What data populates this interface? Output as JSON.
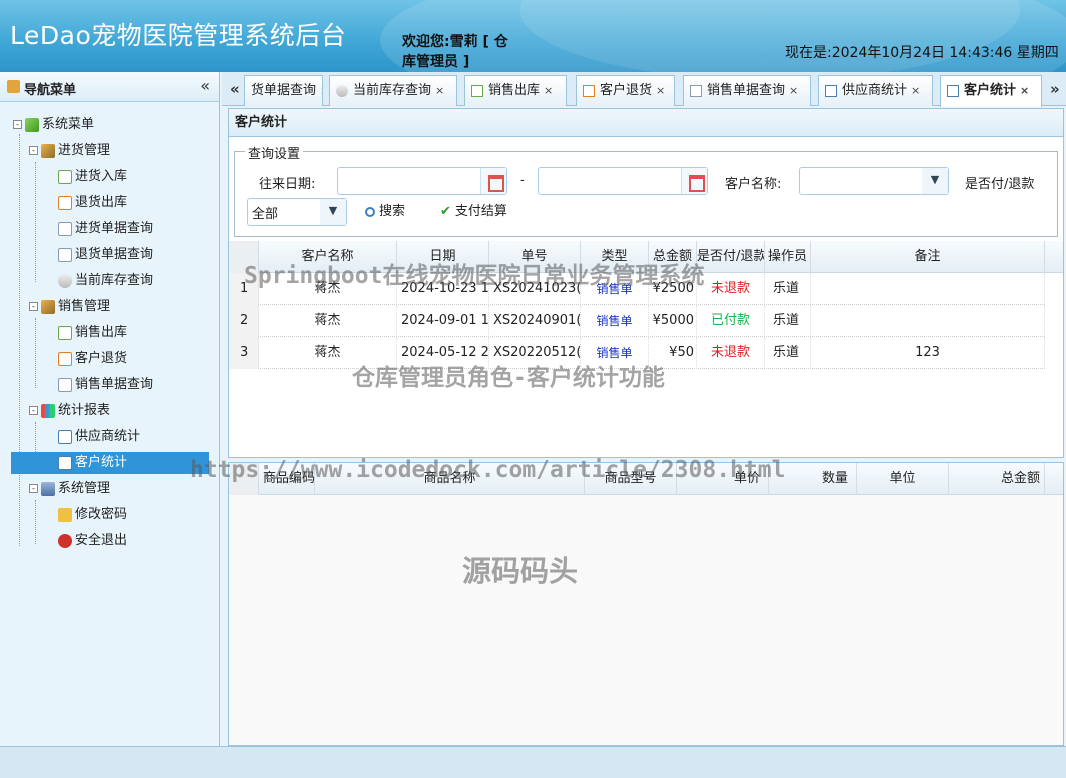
{
  "header": {
    "title": "LeDao宠物医院管理系统后台",
    "welcome": "欢迎您:雪莉 [ 仓库管理员 ]",
    "datetime": "现在是:2024年10月24日 14:43:46 星期四"
  },
  "sidebar": {
    "title": "导航菜单",
    "collapse": "«",
    "root": "系统菜单",
    "groups": [
      {
        "label": "进货管理",
        "items": [
          "进货入库",
          "退货出库",
          "进货单据查询",
          "退货单据查询",
          "当前库存查询"
        ]
      },
      {
        "label": "销售管理",
        "items": [
          "销售出库",
          "客户退货",
          "销售单据查询"
        ]
      },
      {
        "label": "统计报表",
        "items": [
          "供应商统计",
          "客户统计"
        ]
      },
      {
        "label": "系统管理",
        "items": [
          "修改密码",
          "安全退出"
        ]
      }
    ],
    "selected": "客户统计"
  },
  "tabs": {
    "left_arrow": "«",
    "right_arrow": "»",
    "items": [
      "货单据查询",
      "当前库存查询",
      "销售出库",
      "客户退货",
      "销售单据查询",
      "供应商统计",
      "客户统计"
    ],
    "active": "客户统计",
    "close": "×"
  },
  "panel": {
    "title": "客户统计",
    "query_legend": "查询设置",
    "date_label": "往来日期:",
    "date_sep": "-",
    "date_from": "",
    "date_to": "",
    "customer_label": "客户名称:",
    "customer_value": "",
    "paid_label": "是否付/退款",
    "paid_value": "全部",
    "search_btn": "搜索",
    "settle_btn": "支付结算"
  },
  "grid": {
    "columns": [
      "客户名称",
      "日期",
      "单号",
      "类型",
      "总金额",
      "是否付/退款",
      "操作员",
      "备注"
    ],
    "rows": [
      {
        "n": "1",
        "customer": "蒋杰",
        "date": "2024-10-23 1",
        "no": "XS20241023(",
        "type": "销售单",
        "amount": "¥2500",
        "paid": "未退款",
        "op": "乐道",
        "note": ""
      },
      {
        "n": "2",
        "customer": "蒋杰",
        "date": "2024-09-01 1",
        "no": "XS20240901(",
        "type": "销售单",
        "amount": "¥5000",
        "paid": "已付款",
        "op": "乐道",
        "note": ""
      },
      {
        "n": "3",
        "customer": "蒋杰",
        "date": "2024-05-12 2",
        "no": "XS20220512(",
        "type": "销售单",
        "amount": "¥50",
        "paid": "未退款",
        "op": "乐道",
        "note": "123"
      }
    ]
  },
  "grid2": {
    "columns": [
      "商品编码",
      "商品名称",
      "商品型号",
      "单价",
      "数量",
      "单位",
      "总金额"
    ]
  },
  "watermarks": {
    "line1": "Springboot在线宠物医院日常业务管理系统",
    "line2": "仓库管理员角色-客户统计功能",
    "line3": "https://www.icodedock.com/article/2308.html",
    "line4": "源码码头"
  },
  "colors": {
    "header": "#3fa6d6",
    "selected": "#2f95d8",
    "unpaid": "#e02020",
    "paid": "#17b34a",
    "type": "#1a33c8"
  }
}
